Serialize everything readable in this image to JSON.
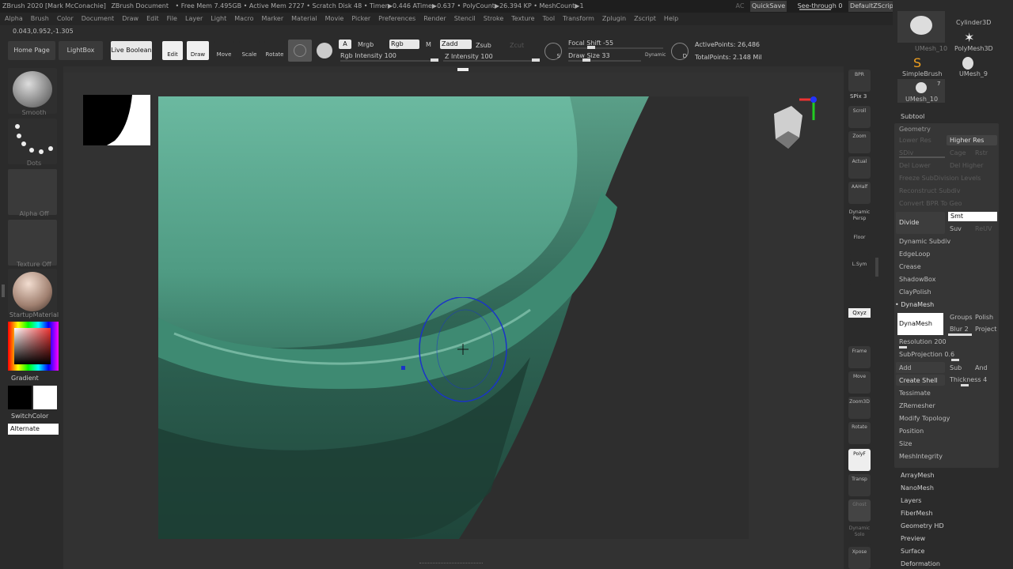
{
  "title_bar": {
    "app": "ZBrush 2020 [Mark McConachie]",
    "doc": "ZBrush Document",
    "stats": "• Free Mem 7.495GB • Active Mem 2727 • Scratch Disk 48 • Timer▶0.446 ATime▶0.637 • PolyCount▶26.394 KP • MeshCount▶1",
    "ac": "AC",
    "quicksave": "QuickSave",
    "see_through": "See-through  0",
    "script": "DefaultZScript"
  },
  "menu": [
    "Alpha",
    "Brush",
    "Color",
    "Document",
    "Draw",
    "Edit",
    "File",
    "Layer",
    "Light",
    "Macro",
    "Marker",
    "Material",
    "Movie",
    "Picker",
    "Preferences",
    "Render",
    "Stencil",
    "Stroke",
    "Texture",
    "Tool",
    "Transform",
    "Zplugin",
    "Zscript",
    "Help"
  ],
  "coords": "0.043,0.952,-1.305",
  "toolbar": {
    "home": "Home Page",
    "lightbox": "LightBox",
    "live_boolean": "Live Boolean",
    "edit": "Edit",
    "draw": "Draw",
    "move": "Move",
    "scale": "Scale",
    "rotate": "Rotate",
    "a": "A",
    "mrgb": "Mrgb",
    "rgb": "Rgb",
    "m": "M",
    "zadd": "Zadd",
    "zsub": "Zsub",
    "zcut": "Zcut",
    "rgb_intensity": "Rgb Intensity 100",
    "z_intensity": "Z Intensity 100",
    "focal_shift": "Focal Shift -55",
    "draw_size": "Draw Size 33",
    "dynamic": "Dynamic",
    "active_points": "ActivePoints: 26,486",
    "total_points": "TotalPoints: 2.148 Mil",
    "s": "S",
    "d": "D"
  },
  "left_panel": {
    "smooth": "Smooth",
    "dots": "Dots",
    "alpha_off": "Alpha Off",
    "texture_off": "Texture Off",
    "material": "StartupMaterial",
    "gradient": "Gradient",
    "switch_color": "SwitchColor",
    "alternate": "Alternate"
  },
  "right_strip": [
    "BPR",
    "SPix 3",
    "Scroll",
    "Zoom",
    "Actual",
    "AAHalf",
    "Dynamic Persp",
    "Floor",
    "L.Sym",
    "",
    "Qxyz",
    "",
    "",
    "Frame",
    "Move",
    "Zoom3D",
    "Rotate",
    "PolyF",
    "Transp",
    "Ghost",
    "Dynamic Solo",
    "Xpose"
  ],
  "tool_thumbs": {
    "umesh10a": "UMesh_10",
    "cylinder": "Cylinder3D",
    "polymesh": "PolyMesh3D",
    "simplebrush": "SimpleBrush",
    "umesh9": "UMesh_9",
    "umesh10b": "UMesh_10",
    "count": "7"
  },
  "subtool": {
    "subtool": "Subtool",
    "geometry": "Geometry",
    "lower_res": "Lower Res",
    "higher_res": "Higher Res",
    "sdiv": "SDiv",
    "cage": "Cage",
    "rstr": "Rstr",
    "del_lower": "Del Lower",
    "del_higher": "Del Higher",
    "freeze": "Freeze SubDivision Levels",
    "reconstruct": "Reconstruct Subdiv",
    "convert": "Convert BPR To Geo",
    "divide": "Divide",
    "smt": "Smt",
    "suv": "Suv",
    "reluv": "ReUV",
    "dynamic_subdiv": "Dynamic Subdiv",
    "edgeloop": "EdgeLoop",
    "crease": "Crease",
    "shadowbox": "ShadowBox",
    "claypolish": "ClayPolish",
    "dynamesh_header": "• DynaMesh",
    "dynamesh_btn": "DynaMesh",
    "groups": "Groups",
    "polish": "Polish",
    "blur": "Blur 2",
    "project": "Project",
    "resolution": "Resolution 200",
    "subprojection": "SubProjection 0.6",
    "add": "Add",
    "sub": "Sub",
    "and": "And",
    "create_shell": "Create Shell",
    "thickness": "Thickness 4",
    "tessimate": "Tessimate",
    "zremesher": "ZRemesher",
    "modify_topology": "Modify Topology",
    "position": "Position",
    "size": "Size",
    "meshintegrity": "MeshIntegrity",
    "arraymesh": "ArrayMesh",
    "nanomesh": "NanoMesh",
    "layers": "Layers",
    "fibermesh": "FiberMesh",
    "geometry_hd": "Geometry HD",
    "preview": "Preview",
    "surface": "Surface",
    "deformation": "Deformation"
  },
  "colors": {
    "mesh": "#5aa58d",
    "brush_ring": "#1a33c8",
    "bg": "#2b2b2b"
  }
}
